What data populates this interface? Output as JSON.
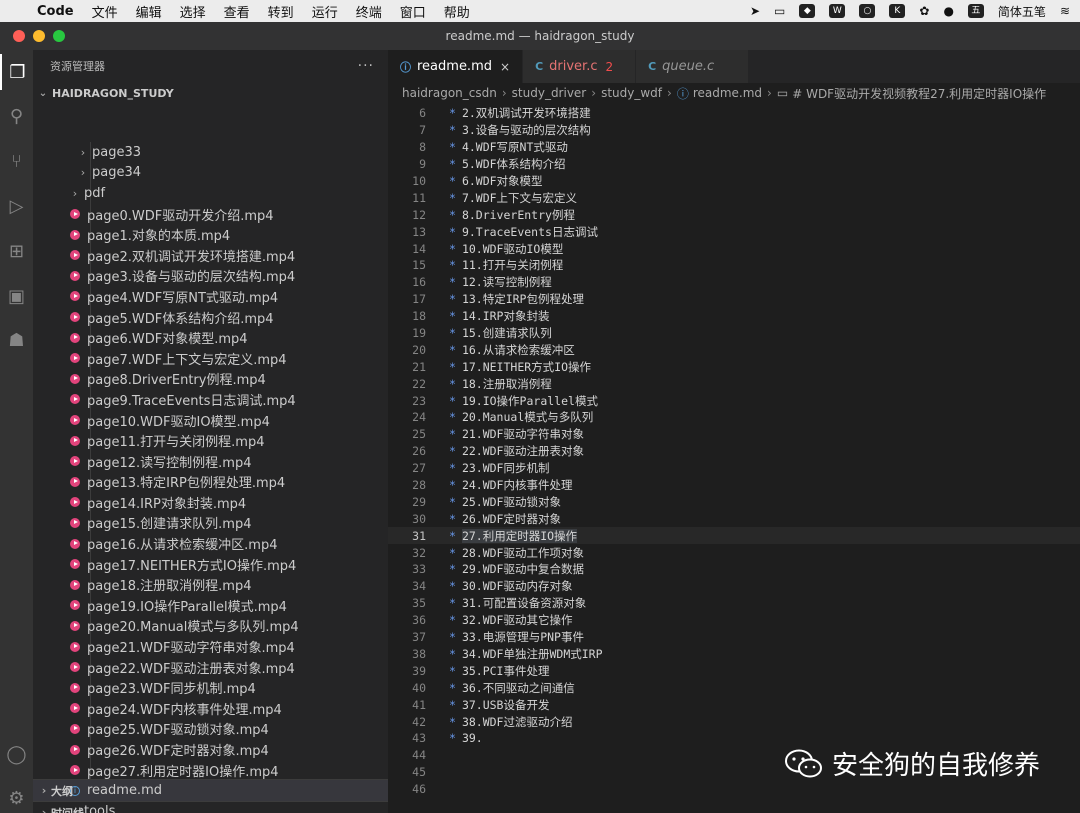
{
  "menubar": {
    "app": "Code",
    "items": [
      "文件",
      "编辑",
      "选择",
      "查看",
      "转到",
      "运行",
      "终端",
      "窗口",
      "帮助"
    ],
    "input_method": "简体五笔"
  },
  "window": {
    "title": "readme.md — haidragon_study"
  },
  "sidebar": {
    "header": "资源管理器",
    "more": "···",
    "root": "HAIDRAGON_STUDY",
    "rows": [
      {
        "label": "page33",
        "kind": "folder",
        "indent": 2
      },
      {
        "label": "page34",
        "kind": "folder",
        "indent": 2
      },
      {
        "label": "pdf",
        "kind": "folder",
        "indent": 1
      },
      {
        "label": "page0.WDF驱动开发介绍.mp4",
        "kind": "mp4"
      },
      {
        "label": "page1.对象的本质.mp4",
        "kind": "mp4"
      },
      {
        "label": "page2.双机调试开发环境搭建.mp4",
        "kind": "mp4"
      },
      {
        "label": "page3.设备与驱动的层次结构.mp4",
        "kind": "mp4"
      },
      {
        "label": "page4.WDF写原NT式驱动.mp4",
        "kind": "mp4"
      },
      {
        "label": "page5.WDF体系结构介绍.mp4",
        "kind": "mp4"
      },
      {
        "label": "page6.WDF对象模型.mp4",
        "kind": "mp4"
      },
      {
        "label": "page7.WDF上下文与宏定义.mp4",
        "kind": "mp4"
      },
      {
        "label": "page8.DriverEntry例程.mp4",
        "kind": "mp4"
      },
      {
        "label": "page9.TraceEvents日志调试.mp4",
        "kind": "mp4"
      },
      {
        "label": "page10.WDF驱动IO模型.mp4",
        "kind": "mp4"
      },
      {
        "label": "page11.打开与关闭例程.mp4",
        "kind": "mp4"
      },
      {
        "label": "page12.读写控制例程.mp4",
        "kind": "mp4"
      },
      {
        "label": "page13.特定IRP包例程处理.mp4",
        "kind": "mp4"
      },
      {
        "label": "page14.IRP对象封装.mp4",
        "kind": "mp4"
      },
      {
        "label": "page15.创建请求队列.mp4",
        "kind": "mp4"
      },
      {
        "label": "page16.从请求检索缓冲区.mp4",
        "kind": "mp4"
      },
      {
        "label": "page17.NEITHER方式IO操作.mp4",
        "kind": "mp4"
      },
      {
        "label": "page18.注册取消例程.mp4",
        "kind": "mp4"
      },
      {
        "label": "page19.IO操作Parallel模式.mp4",
        "kind": "mp4"
      },
      {
        "label": "page20.Manual模式与多队列.mp4",
        "kind": "mp4"
      },
      {
        "label": "page21.WDF驱动字符串对象.mp4",
        "kind": "mp4"
      },
      {
        "label": "page22.WDF驱动注册表对象.mp4",
        "kind": "mp4"
      },
      {
        "label": "page23.WDF同步机制.mp4",
        "kind": "mp4"
      },
      {
        "label": "page24.WDF内核事件处理.mp4",
        "kind": "mp4"
      },
      {
        "label": "page25.WDF驱动锁对象.mp4",
        "kind": "mp4"
      },
      {
        "label": "page26.WDF定时器对象.mp4",
        "kind": "mp4"
      },
      {
        "label": "page27.利用定时器IO操作.mp4",
        "kind": "mp4"
      },
      {
        "label": "readme.md",
        "kind": "info",
        "selected": true
      },
      {
        "label": "tools",
        "kind": "folder",
        "indent": 1
      }
    ],
    "outline": "大纲",
    "timeline": "时间线"
  },
  "editor": {
    "tabs": [
      {
        "icon": "ⓘ",
        "label": "readme.md",
        "close": "×",
        "active": true
      },
      {
        "icon": "C",
        "label": "driver.c",
        "badge": "2"
      },
      {
        "icon": "C",
        "label": "queue.c"
      }
    ],
    "breadcrumb": [
      "haidragon_csdn",
      "study_driver",
      "study_wdf",
      "readme.md",
      "# WDF驱动开发视频教程27.利用定时器IO操作"
    ],
    "current_line": 31,
    "lines": [
      {
        "n": 6,
        "t": "2.双机调试开发环境搭建"
      },
      {
        "n": 7,
        "t": "3.设备与驱动的层次结构"
      },
      {
        "n": 8,
        "t": "4.WDF写原NT式驱动"
      },
      {
        "n": 9,
        "t": "5.WDF体系结构介绍"
      },
      {
        "n": 10,
        "t": "6.WDF对象模型"
      },
      {
        "n": 11,
        "t": "7.WDF上下文与宏定义"
      },
      {
        "n": 12,
        "t": "8.DriverEntry例程"
      },
      {
        "n": 13,
        "t": "9.TraceEvents日志调试"
      },
      {
        "n": 14,
        "t": "10.WDF驱动IO模型"
      },
      {
        "n": 15,
        "t": "11.打开与关闭例程"
      },
      {
        "n": 16,
        "t": "12.读写控制例程"
      },
      {
        "n": 17,
        "t": "13.特定IRP包例程处理"
      },
      {
        "n": 18,
        "t": "14.IRP对象封装"
      },
      {
        "n": 19,
        "t": "15.创建请求队列"
      },
      {
        "n": 20,
        "t": "16.从请求检索缓冲区"
      },
      {
        "n": 21,
        "t": "17.NEITHER方式IO操作"
      },
      {
        "n": 22,
        "t": "18.注册取消例程"
      },
      {
        "n": 23,
        "t": "19.IO操作Parallel模式"
      },
      {
        "n": 24,
        "t": "20.Manual模式与多队列"
      },
      {
        "n": 25,
        "t": "21.WDF驱动字符串对象"
      },
      {
        "n": 26,
        "t": "22.WDF驱动注册表对象"
      },
      {
        "n": 27,
        "t": "23.WDF同步机制"
      },
      {
        "n": 28,
        "t": "24.WDF内核事件处理"
      },
      {
        "n": 29,
        "t": "25.WDF驱动锁对象"
      },
      {
        "n": 30,
        "t": "26.WDF定时器对象"
      },
      {
        "n": 31,
        "t": "27.利用定时器IO操作"
      },
      {
        "n": 32,
        "t": "28.WDF驱动工作项对象"
      },
      {
        "n": 33,
        "t": "29.WDF驱动中复合数据"
      },
      {
        "n": 34,
        "t": "30.WDF驱动内存对象"
      },
      {
        "n": 35,
        "t": "31.可配置设备资源对象"
      },
      {
        "n": 36,
        "t": "32.WDF驱动其它操作"
      },
      {
        "n": 37,
        "t": "33.电源管理与PNP事件"
      },
      {
        "n": 38,
        "t": "34.WDF单独注册WDM式IRP"
      },
      {
        "n": 39,
        "t": "35.PCI事件处理"
      },
      {
        "n": 40,
        "t": "36.不同驱动之间通信"
      },
      {
        "n": 41,
        "t": "37.USB设备开发"
      },
      {
        "n": 42,
        "t": "38.WDF过滤驱动介绍"
      },
      {
        "n": 43,
        "t": "39."
      },
      {
        "n": 44,
        "t": ""
      },
      {
        "n": 45,
        "t": ""
      },
      {
        "n": 46,
        "t": ""
      }
    ]
  },
  "watermark": {
    "text": "安全狗的自我修养"
  },
  "colors": {
    "mp4_icon": "#e2447c",
    "bullet": "#6796e6",
    "accent": "#007acc"
  }
}
